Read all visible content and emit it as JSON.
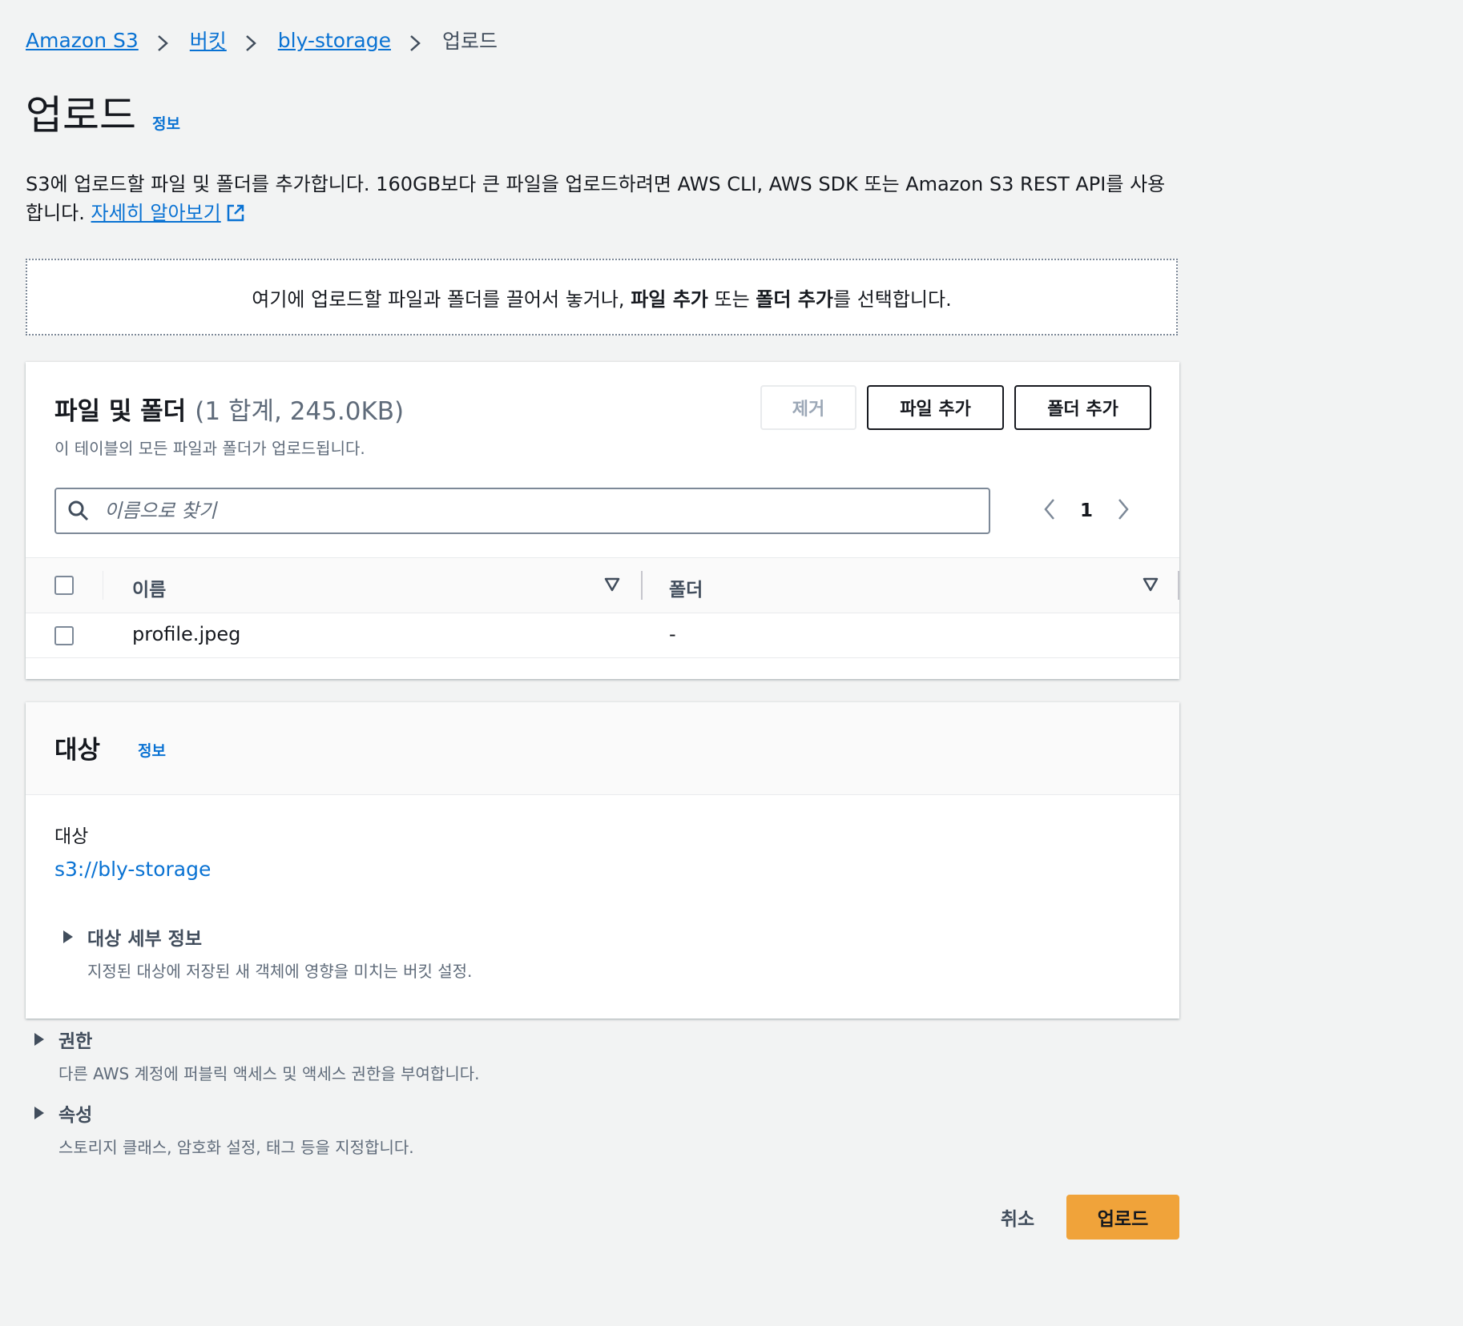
{
  "breadcrumb": {
    "items": [
      "Amazon S3",
      "버킷",
      "bly-storage"
    ],
    "current": "업로드"
  },
  "page": {
    "title": "업로드",
    "info": "정보",
    "description": "S3에 업로드할 파일 및 폴더를 추가합니다. 160GB보다 큰 파일을 업로드하려면 AWS CLI, AWS SDK 또는 Amazon S3 REST API를 사용합니다.",
    "learn_more": "자세히 알아보기"
  },
  "dropzone": {
    "prefix": "여기에 업로드할 파일과 폴더를 끌어서 놓거나, ",
    "bold1": "파일 추가",
    "middle": " 또는 ",
    "bold2": "폴더 추가",
    "suffix": "를 선택합니다."
  },
  "files": {
    "title": "파일 및 폴더",
    "count": "(1 합계, 245.0KB)",
    "subtitle": "이 테이블의 모든 파일과 폴더가 업로드됩니다.",
    "remove_label": "제거",
    "add_file_label": "파일 추가",
    "add_folder_label": "폴더 추가",
    "search_placeholder": "이름으로 찾기",
    "page": "1",
    "columns": [
      "이름",
      "폴더"
    ],
    "rows": [
      {
        "name": "profile.jpeg",
        "folder": "-"
      }
    ]
  },
  "destination": {
    "title": "대상",
    "info": "정보",
    "label": "대상",
    "value": "s3://bly-storage",
    "details_title": "대상 세부 정보",
    "details_sub": "지정된 대상에 저장된 새 객체에 영향을 미치는 버킷 설정."
  },
  "permissions": {
    "title": "권한",
    "sub": "다른 AWS 계정에 퍼블릭 액세스 및 액세스 권한을 부여합니다."
  },
  "properties": {
    "title": "속성",
    "sub": "스토리지 클래스, 암호화 설정, 태그 등을 지정합니다."
  },
  "actions": {
    "cancel_label": "취소",
    "upload_label": "업로드"
  },
  "colors": {
    "link": "#0972d3",
    "primary_button": "#f0a33a",
    "background": "#f2f3f3"
  }
}
